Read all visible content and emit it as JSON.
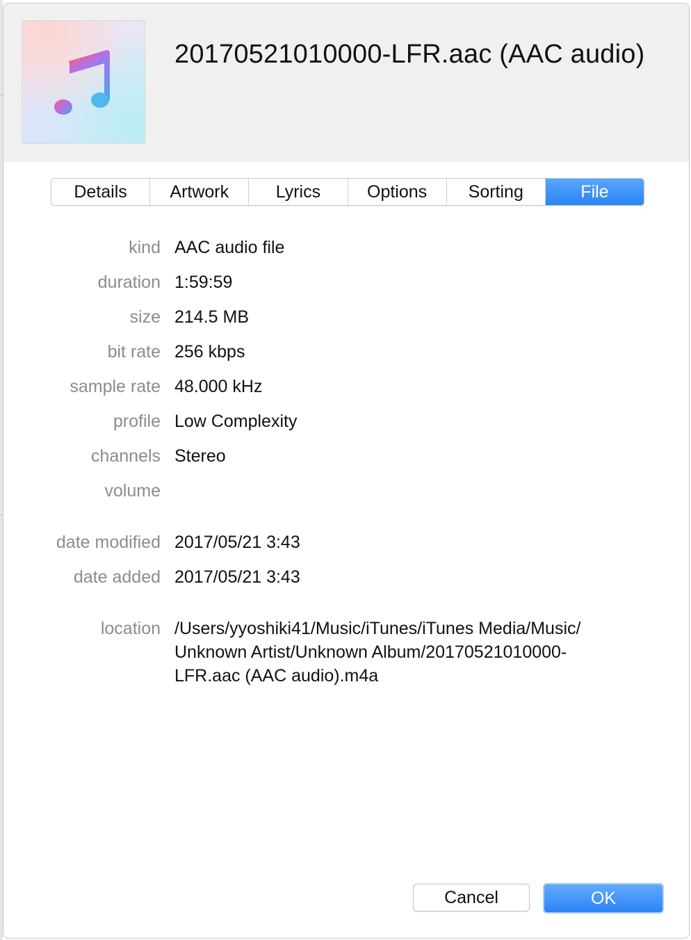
{
  "window": {
    "title": "20170521010000-LFR.aac (AAC audio)",
    "artwork_icon": "music-note-icon"
  },
  "tabs": [
    {
      "label": "Details",
      "active": false
    },
    {
      "label": "Artwork",
      "active": false
    },
    {
      "label": "Lyrics",
      "active": false
    },
    {
      "label": "Options",
      "active": false
    },
    {
      "label": "Sorting",
      "active": false
    },
    {
      "label": "File",
      "active": true
    }
  ],
  "file_info": {
    "kind": {
      "label": "kind",
      "value": "AAC audio file"
    },
    "duration": {
      "label": "duration",
      "value": "1:59:59"
    },
    "size": {
      "label": "size",
      "value": "214.5 MB"
    },
    "bit_rate": {
      "label": "bit rate",
      "value": "256 kbps"
    },
    "sample_rate": {
      "label": "sample rate",
      "value": "48.000 kHz"
    },
    "profile": {
      "label": "profile",
      "value": "Low Complexity"
    },
    "channels": {
      "label": "channels",
      "value": "Stereo"
    },
    "volume": {
      "label": "volume",
      "value": ""
    },
    "date_modified": {
      "label": "date modified",
      "value": "2017/05/21 3:43"
    },
    "date_added": {
      "label": "date added",
      "value": "2017/05/21 3:43"
    },
    "location": {
      "label": "location",
      "line1": "/Users/yyoshiki41/Music/iTunes/iTunes Media/Music/",
      "line2": "Unknown Artist/Unknown Album/20170521010000-",
      "line3": "LFR.aac (AAC audio).m4a"
    }
  },
  "buttons": {
    "cancel_label": "Cancel",
    "ok_label": "OK"
  },
  "colors": {
    "accent": "#2a84f5",
    "label_gray": "#8c8c8c",
    "header_bg": "#f0f0f0"
  }
}
